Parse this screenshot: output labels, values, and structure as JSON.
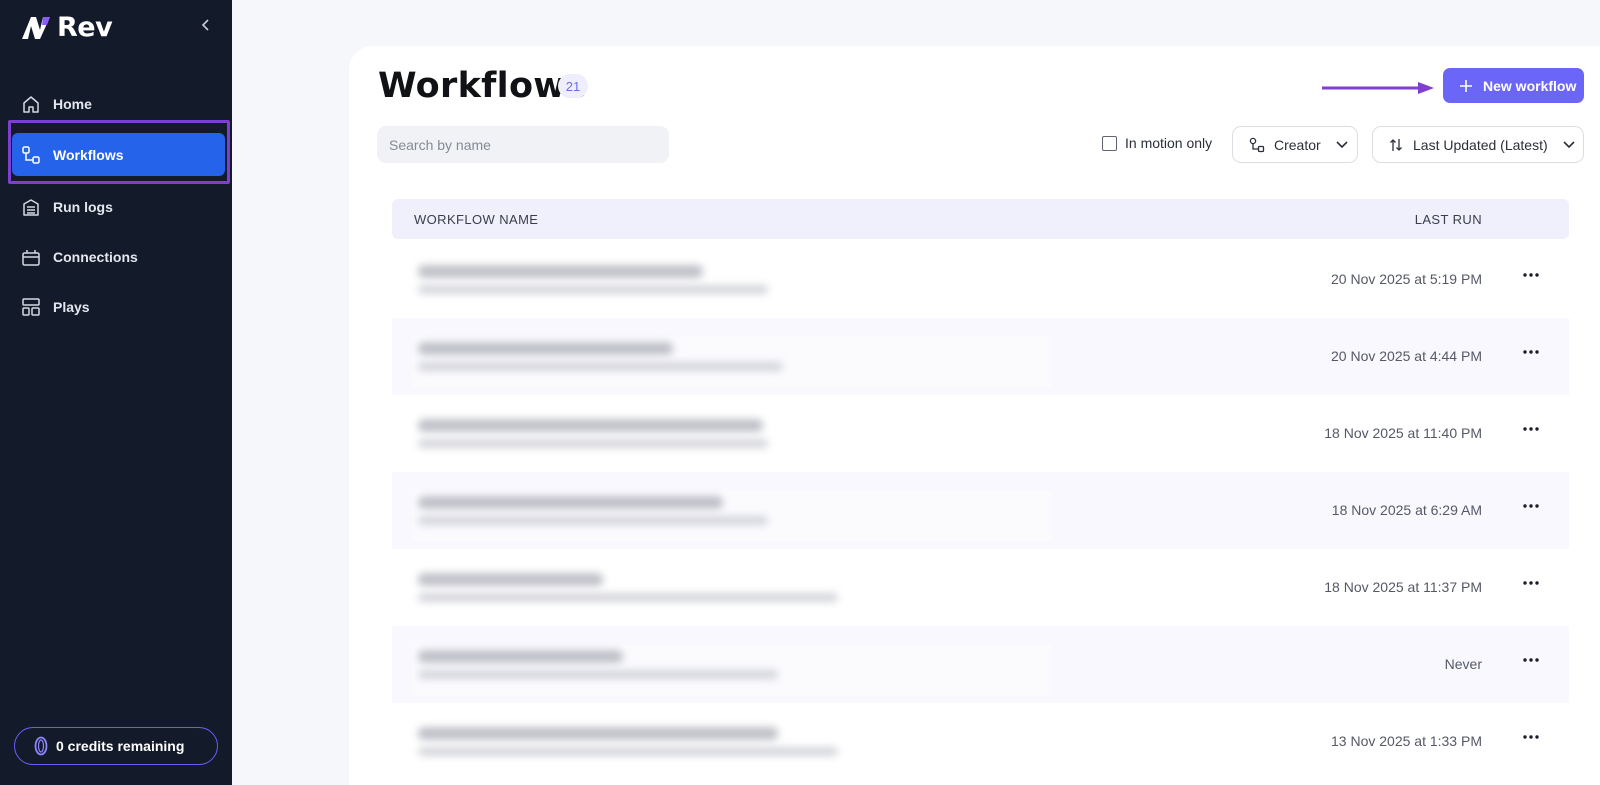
{
  "sidebar": {
    "brand": "Rev",
    "items": [
      {
        "label": "Home",
        "icon": "home-icon"
      },
      {
        "label": "Workflows",
        "icon": "workflow-icon",
        "active": true
      },
      {
        "label": "Run logs",
        "icon": "run-logs-icon"
      },
      {
        "label": "Connections",
        "icon": "connections-icon"
      },
      {
        "label": "Plays",
        "icon": "plays-icon"
      }
    ],
    "credits_label": "0 credits remaining"
  },
  "header": {
    "title": "Workflows",
    "count": "21",
    "new_button_label": "New workflow"
  },
  "filters": {
    "search_placeholder": "Search by name",
    "search_value": "",
    "in_motion_label": "In motion only",
    "in_motion_checked": false,
    "creator_label": "Creator",
    "sort_label": "Last Updated (Latest)"
  },
  "table": {
    "columns": [
      "WORKFLOW NAME",
      "LAST RUN"
    ],
    "rows": [
      {
        "last_run": "20 Nov 2025 at 5:19 PM"
      },
      {
        "last_run": "20 Nov 2025 at 4:44 PM"
      },
      {
        "last_run": "18 Nov 2025 at 11:40 PM"
      },
      {
        "last_run": "18 Nov 2025 at 6:29 AM"
      },
      {
        "last_run": "18 Nov 2025 at 11:37 PM"
      },
      {
        "last_run": "Never"
      },
      {
        "last_run": "13 Nov 2025 at 1:33 PM"
      }
    ]
  },
  "colors": {
    "sidebar_bg": "#131a2a",
    "active_nav": "#2563eb",
    "highlight_outline": "#7e3fd0",
    "primary_button": "#6b66f7",
    "header_row_bg": "#f0effc"
  }
}
